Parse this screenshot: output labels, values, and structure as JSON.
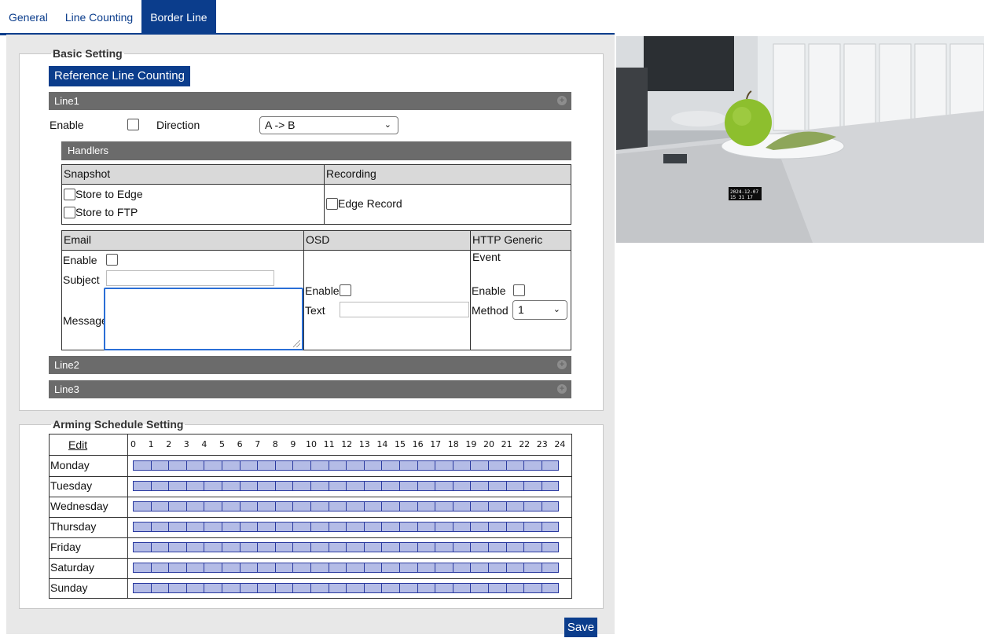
{
  "tabs": [
    {
      "label": "General",
      "active": false
    },
    {
      "label": "Line Counting",
      "active": false
    },
    {
      "label": "Border Line",
      "active": true
    }
  ],
  "basic_setting": {
    "legend": "Basic Setting",
    "reference_button": "Reference Line Counting",
    "lines": [
      "Line1",
      "Line2",
      "Line3"
    ],
    "enable_label": "Enable",
    "direction_label": "Direction",
    "direction_value": "A -> B",
    "handlers_label": "Handlers",
    "snapshot": {
      "header": "Snapshot",
      "store_edge": "Store to Edge",
      "store_ftp": "Store to FTP"
    },
    "recording": {
      "header": "Recording",
      "edge_record": "Edge Record"
    },
    "email": {
      "header": "Email",
      "enable": "Enable",
      "subject": "Subject",
      "message": "Message"
    },
    "osd": {
      "header": "OSD",
      "enable": "Enable",
      "text": "Text"
    },
    "http": {
      "header": "HTTP Generic Event",
      "enable": "Enable",
      "method": "Method",
      "method_value": "1"
    }
  },
  "schedule": {
    "legend": "Arming Schedule Setting",
    "edit_label": "Edit",
    "hours": [
      "0",
      "1",
      "2",
      "3",
      "4",
      "5",
      "6",
      "7",
      "8",
      "9",
      "10",
      "11",
      "12",
      "13",
      "14",
      "15",
      "16",
      "17",
      "18",
      "19",
      "20",
      "21",
      "22",
      "23",
      "24"
    ],
    "days": [
      "Monday",
      "Tuesday",
      "Wednesday",
      "Thursday",
      "Friday",
      "Saturday",
      "Sunday"
    ]
  },
  "save_label": "Save",
  "camera": {
    "timestamp_line1": "2024-12-07",
    "timestamp_line2": "15 31 17"
  },
  "colors": {
    "brand": "#0b3d8c",
    "bar": "#6b6b6b",
    "schedule_fill": "#b4bce6",
    "focus": "#2a6fd6"
  }
}
